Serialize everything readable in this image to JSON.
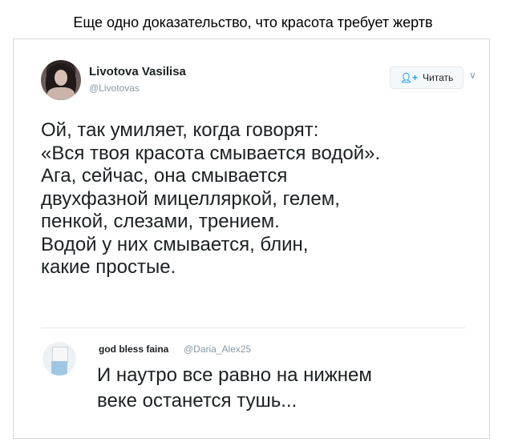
{
  "caption": "Еще одно доказательство, что красота требует жертв",
  "tweet": {
    "display_name": "Livotova Vasilisa",
    "handle": "@Livotovas",
    "follow_label": "Читать",
    "follow_icon": "+",
    "lines": [
      "Ой, так умиляет, когда говорят:",
      "«Вся твоя красота смывается водой».",
      "Ага, сейчас, она смывается",
      "двухфазной мицелляркой, гелем,",
      "пенкой, слезами, трением.",
      "Водой у них смывается, блин,",
      "какие простые."
    ]
  },
  "reply": {
    "display_name": "god bless faina",
    "handle": "@Daria_Alex25",
    "lines": [
      "И наутро все равно на нижнем",
      "веке останется тушь..."
    ]
  },
  "colors": {
    "text": "#1c2022",
    "muted": "#8899a6",
    "accent": "#1da1f2",
    "border": "#e1e8ed"
  }
}
